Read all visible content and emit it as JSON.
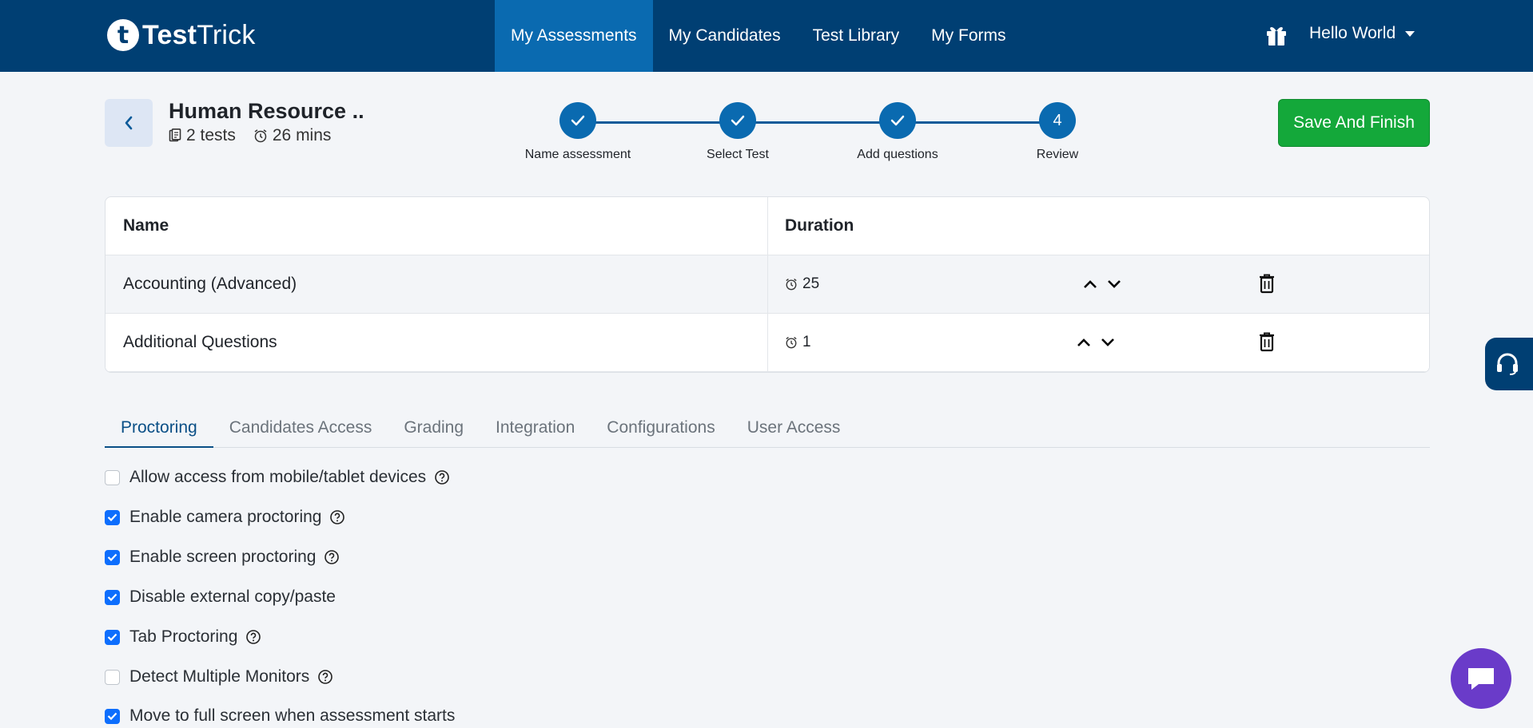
{
  "brand": {
    "logo_letter": "t",
    "name_bold": "Test",
    "name_light": "Trick"
  },
  "nav": {
    "items": [
      {
        "label": "My Assessments",
        "active": true
      },
      {
        "label": "My Candidates"
      },
      {
        "label": "Test Library"
      },
      {
        "label": "My Forms"
      }
    ],
    "user_label": "Hello World"
  },
  "assessment": {
    "title": "Human Resource ..",
    "tests_count": "2 tests",
    "duration": "26 mins"
  },
  "stepper": {
    "steps": [
      {
        "label": "Name assessment",
        "state": "done"
      },
      {
        "label": "Select Test",
        "state": "done"
      },
      {
        "label": "Add questions",
        "state": "done"
      },
      {
        "label": "Review",
        "state": "current",
        "number": "4"
      }
    ]
  },
  "save_button": "Save And Finish",
  "table": {
    "headers": {
      "name": "Name",
      "duration": "Duration"
    },
    "rows": [
      {
        "name": "Accounting (Advanced)",
        "duration": "25"
      },
      {
        "name": "Additional Questions",
        "duration": "1"
      }
    ]
  },
  "tabs": [
    {
      "label": "Proctoring",
      "active": true
    },
    {
      "label": "Candidates Access"
    },
    {
      "label": "Grading"
    },
    {
      "label": "Integration"
    },
    {
      "label": "Configurations"
    },
    {
      "label": "User Access"
    }
  ],
  "options": [
    {
      "label": "Allow access from mobile/tablet devices",
      "checked": false,
      "help": true
    },
    {
      "label": "Enable camera proctoring",
      "checked": true,
      "help": true
    },
    {
      "label": "Enable screen proctoring",
      "checked": true,
      "help": true
    },
    {
      "label": "Disable external copy/paste",
      "checked": true,
      "help": false
    },
    {
      "label": "Tab Proctoring",
      "checked": true,
      "help": true
    },
    {
      "label": "Detect Multiple Monitors",
      "checked": false,
      "help": true
    },
    {
      "label": "Move to full screen when assessment starts",
      "checked": true,
      "help": false
    }
  ],
  "colors": {
    "nav_bg": "#003f73",
    "nav_active": "#0a6ab0",
    "save_green": "#14a83a",
    "checkbox_blue": "#0d6efd",
    "chat_purple": "#6a3bc9"
  }
}
